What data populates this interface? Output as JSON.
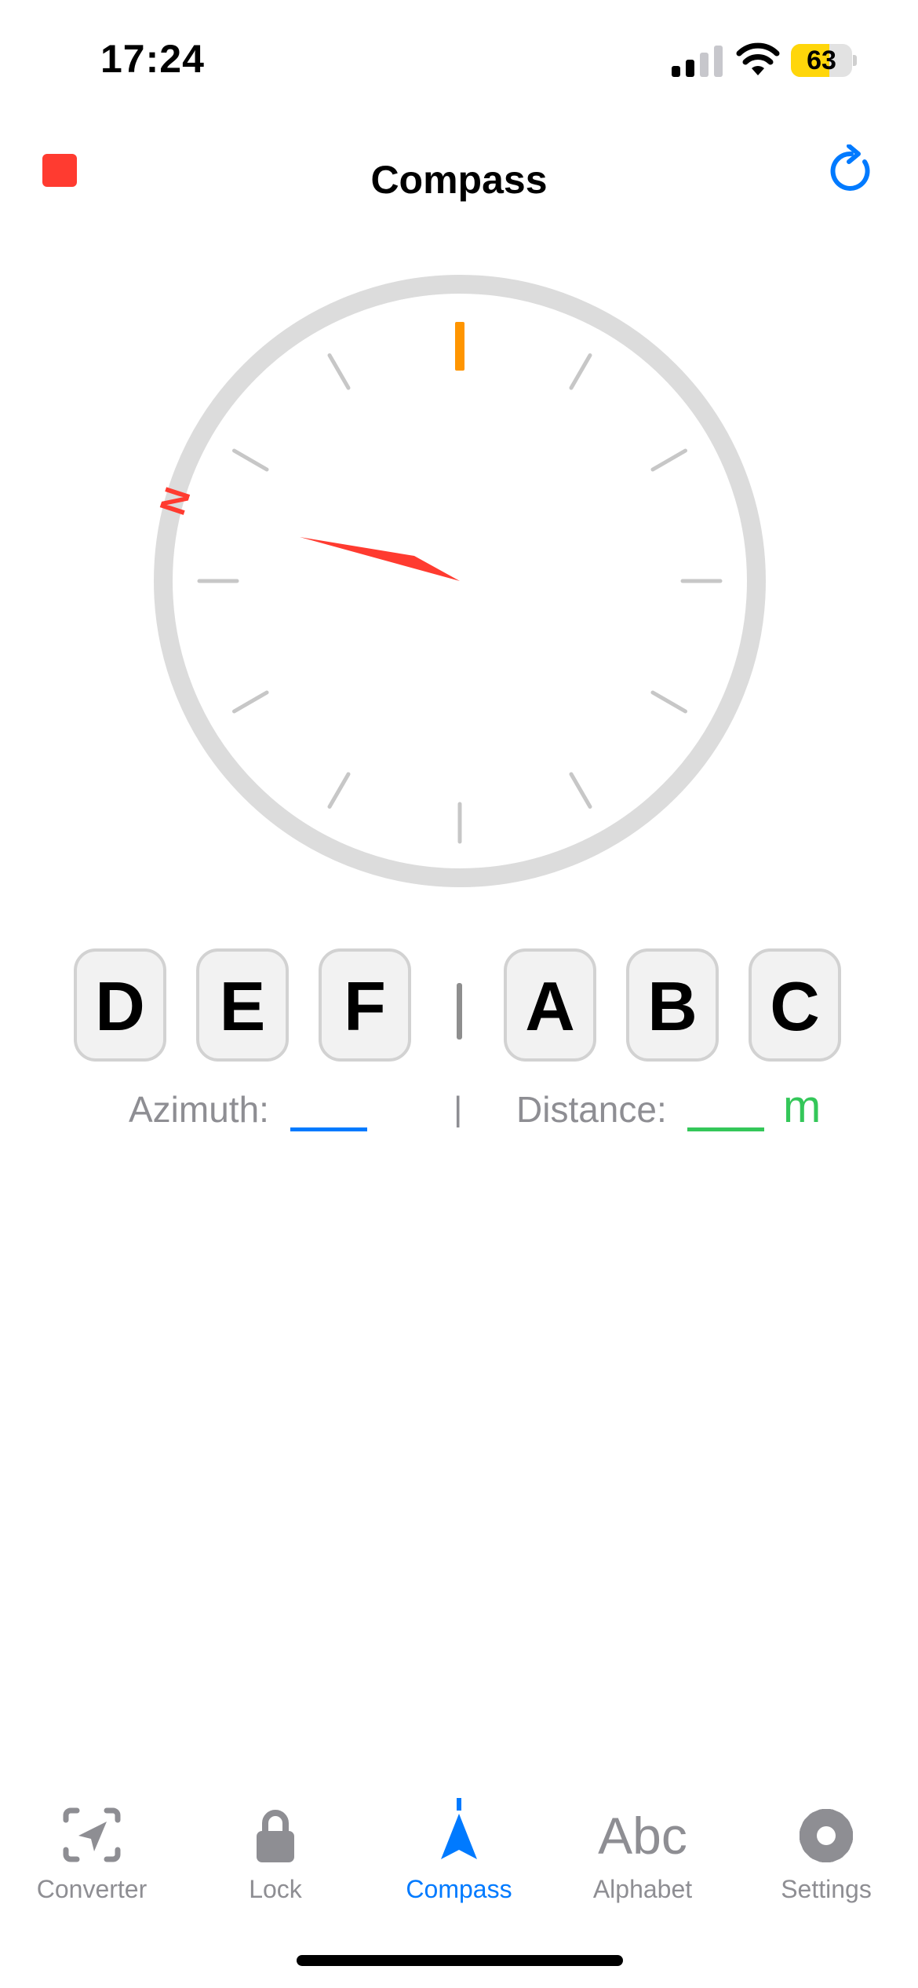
{
  "status_bar": {
    "time": "17:24",
    "battery_level": "63",
    "signal_icon": "cellular-signal-icon",
    "wifi_icon": "wifi-icon",
    "battery_icon": "battery-icon"
  },
  "nav": {
    "title": "Compass",
    "left_icon": "stop-icon",
    "right_icon": "refresh-icon",
    "accent_color": "#007aff",
    "stop_color": "#ff3b30"
  },
  "compass": {
    "north_label": "N",
    "north_color": "#ff3b30",
    "heading_marker_color": "#ff9500",
    "ring_color": "#dcdcdc"
  },
  "keys": {
    "left": [
      "D",
      "E",
      "F"
    ],
    "right": [
      "A",
      "B",
      "C"
    ]
  },
  "readouts": {
    "azimuth_label": "Azimuth:",
    "azimuth_value": "",
    "divider": "|",
    "distance_label": "Distance:",
    "distance_value": "",
    "distance_unit": "m"
  },
  "tabs": [
    {
      "label": "Converter",
      "icon": "location-scan-icon",
      "active": false
    },
    {
      "label": "Lock",
      "icon": "lock-icon",
      "active": false
    },
    {
      "label": "Compass",
      "icon": "compass-arrow-icon",
      "active": true
    },
    {
      "label": "Alphabet",
      "icon": "abc-icon",
      "icon_text": "Abc",
      "active": false
    },
    {
      "label": "Settings",
      "icon": "gear-icon",
      "active": false
    }
  ]
}
